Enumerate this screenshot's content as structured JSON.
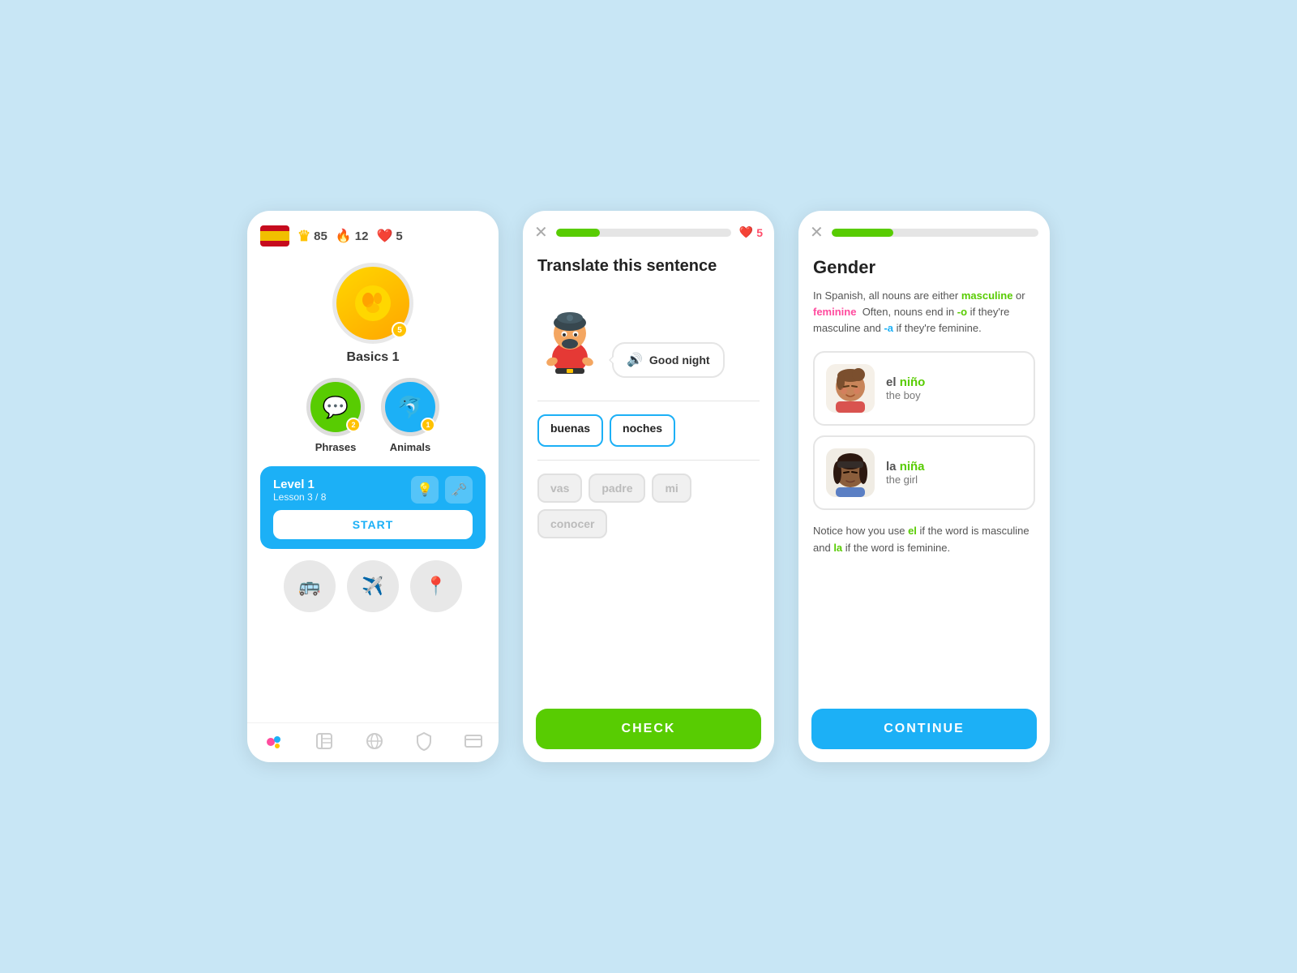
{
  "background": "#c8e6f5",
  "screen1": {
    "flag": "spain",
    "stats": {
      "crown": "85",
      "fire": "12",
      "heart": "5"
    },
    "main_lesson": {
      "label": "Basics 1",
      "badge": "5"
    },
    "sub_lessons": [
      {
        "label": "Phrases",
        "badge": "2",
        "color": "green",
        "emoji": "💬"
      },
      {
        "label": "Animals",
        "badge": "1",
        "color": "blue",
        "emoji": "🐬"
      }
    ],
    "level": {
      "name": "Level 1",
      "sub": "Lesson 3 / 8",
      "start_label": "START"
    },
    "nav_items": [
      "home",
      "book",
      "globe",
      "shield",
      "card"
    ]
  },
  "screen2": {
    "progress": 25,
    "hearts": "5",
    "title": "Translate this sentence",
    "speech_text": "Good night",
    "selected_words": [
      "buenas",
      "noches"
    ],
    "word_bank": [
      {
        "word": "vas",
        "used": false
      },
      {
        "word": "padre",
        "used": false
      },
      {
        "word": "mi",
        "used": false
      },
      {
        "word": "conocer",
        "used": false
      }
    ],
    "check_label": "CHECK"
  },
  "screen3": {
    "progress": 30,
    "title": "Gender",
    "description_parts": [
      "In Spanish, all nouns are either ",
      "masculine",
      " or ",
      "feminine",
      "  Often, nouns end in ",
      "-o",
      " if they're masculine and ",
      "-a",
      " if they're feminine."
    ],
    "cards": [
      {
        "word_prefix": "el ",
        "word_main": "niño",
        "translation": "the boy",
        "avatar_type": "boy"
      },
      {
        "word_prefix": "la ",
        "word_main": "niña",
        "translation": "the girl",
        "avatar_type": "girl"
      }
    ],
    "note_parts": [
      "Notice how you use ",
      "el",
      " if the word is masculine and ",
      "la",
      " if the word is feminine."
    ],
    "continue_label": "CONTINUE"
  }
}
